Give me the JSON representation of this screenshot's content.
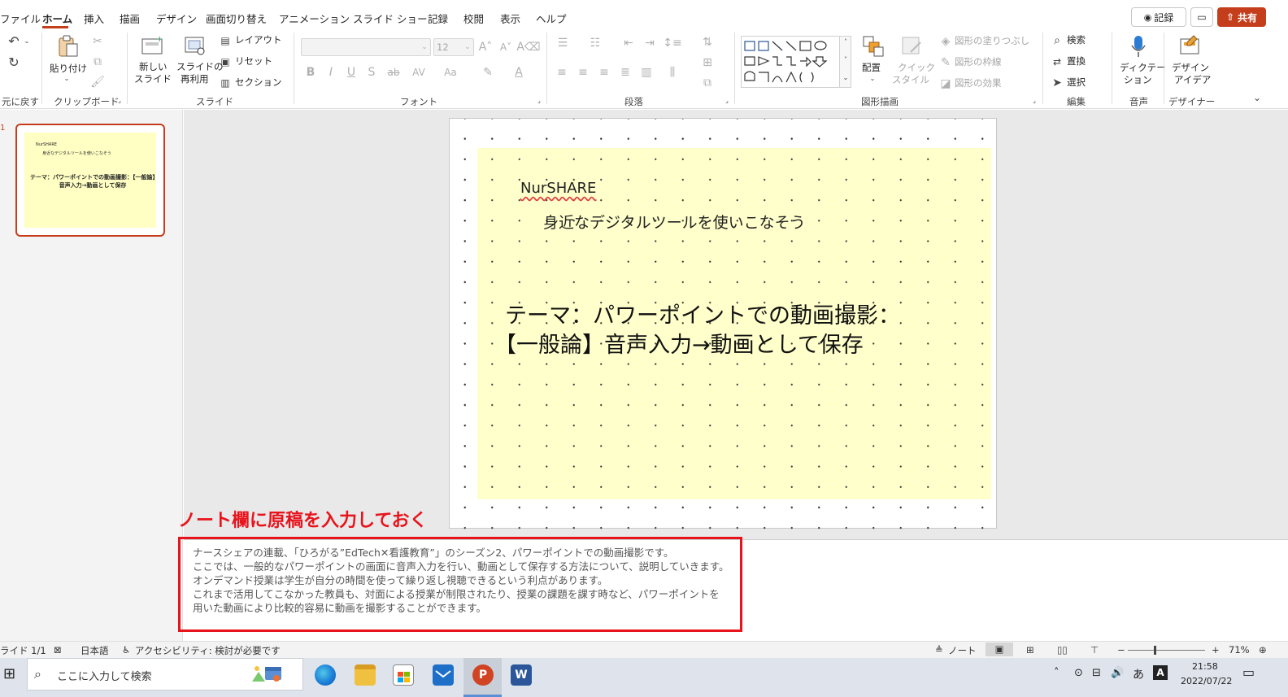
{
  "ribbon_tabs": [
    "ファイル",
    "ホーム",
    "挿入",
    "描画",
    "デザイン",
    "画面切り替え",
    "アニメーション",
    "スライド ショー",
    "記録",
    "校閲",
    "表示",
    "ヘルプ"
  ],
  "active_tab": "ホーム",
  "top_buttons": {
    "record": "記録",
    "share": "共有"
  },
  "groups": {
    "undo": {
      "label": "元に戻す"
    },
    "clipboard": {
      "label": "クリップボード",
      "paste": "貼り付け"
    },
    "slides": {
      "label": "スライド",
      "new_slide_1": "新しい",
      "new_slide_2": "スライド",
      "reuse_1": "スライドの",
      "reuse_2": "再利用",
      "layout": "レイアウト",
      "reset": "リセット",
      "section": "セクション"
    },
    "font": {
      "label": "フォント",
      "size": "12",
      "bold": "B",
      "italic": "I",
      "underline": "U",
      "shadow": "S",
      "strike": "ab",
      "spacing": "AV",
      "case": "Aa",
      "color": "A"
    },
    "paragraph": {
      "label": "段落"
    },
    "drawing": {
      "label": "図形描画",
      "arrange": "配置",
      "quick_style_1": "クイック",
      "quick_style_2": "スタイル",
      "fill": "図形の塗りつぶし",
      "outline": "図形の枠線",
      "effects": "図形の効果"
    },
    "editing": {
      "label": "編集",
      "find": "検索",
      "replace": "置換",
      "select": "選択"
    },
    "voice": {
      "label": "音声",
      "dictate_1": "ディクテー",
      "dictate_2": "ション"
    },
    "designer": {
      "label": "デザイナー",
      "ideas_1": "デザイン",
      "ideas_2": "アイデア"
    }
  },
  "thumbnail": {
    "number": "1",
    "line1": "NurSHARE",
    "line2": "身近なデジタルツールを使いこなそう",
    "title": "テーマ：パワーポイントでの動画撮影：【一般論】音声入力→動画として保存"
  },
  "slide": {
    "brand": "NurSHARE",
    "subtitle": "身近なデジタルツールを使いこなそう",
    "title_line1": "テーマ：パワーポイントでの動画撮影：",
    "title_line2": "【一般論】音声入力→動画として保存"
  },
  "callout_label": "ノート欄に原稿を入力しておく",
  "notes_text": "ナースシェアの連載、「ひろがる”EdTech✕看護教育”」のシーズン2、パワーポイントでの動画撮影です。\nここでは、一般的なパワーポイントの画面に音声入力を行い、動画として保存する方法について、説明していきます。\nオンデマンド授業は学生が自分の時間を使って繰り返し視聴できるという利点があります。\nこれまで活用してこなかった教員も、対面による授業が制限されたり、授業の課題を課す時など、パワーポイントを\n用いた動画により比較的容易に動画を撮影することができます。",
  "status": {
    "slide_count": "ライド 1/1",
    "language": "日本語",
    "accessibility": "アクセシビリティ: 検討が必要です",
    "notes": "ノート",
    "zoom": "71%"
  },
  "taskbar": {
    "search_placeholder": "ここに入力して検索",
    "time": "21:58",
    "date": "2022/07/22",
    "ime": "あ"
  },
  "colors": {
    "accent": "#c43e1c",
    "callout": "#e8141c",
    "slide_fill": "#ffffc4"
  }
}
